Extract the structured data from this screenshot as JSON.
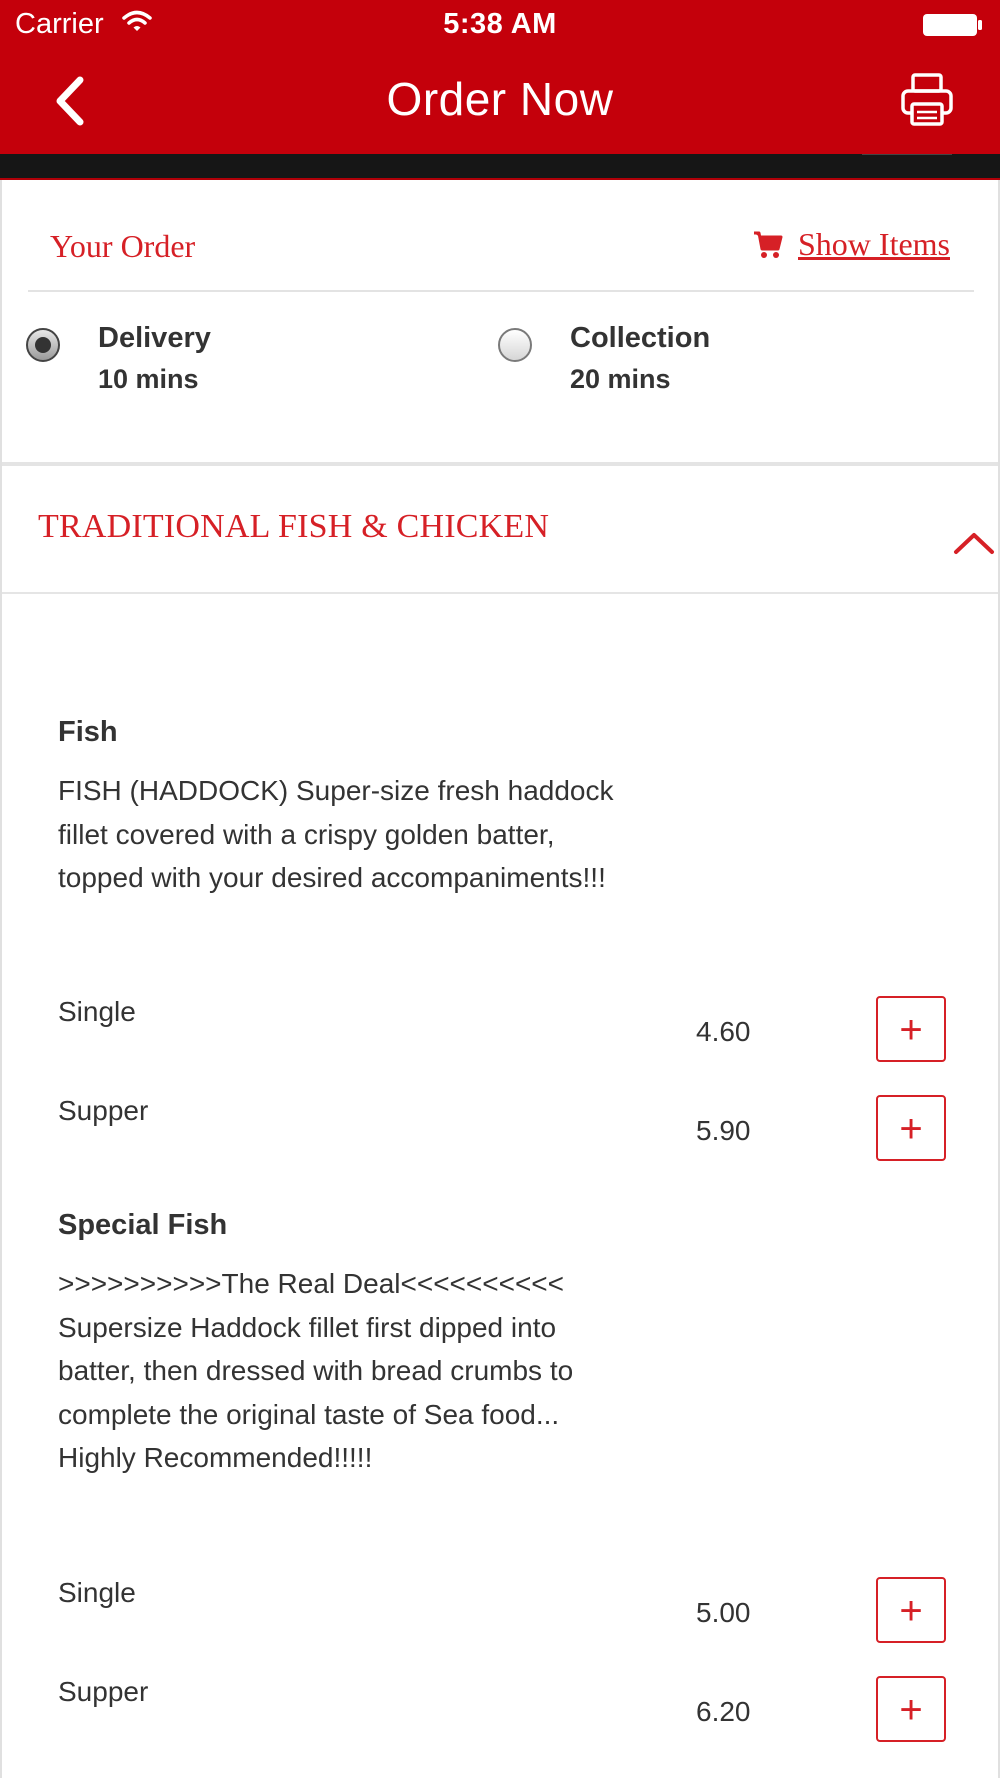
{
  "status_bar": {
    "carrier": "Carrier",
    "time": "5:38 AM"
  },
  "nav": {
    "title": "Order Now",
    "back_icon": "chevron-left-icon",
    "print_icon": "printer-icon"
  },
  "colors": {
    "brand_red": "#c4000b",
    "accent_red": "#d62026"
  },
  "order": {
    "heading": "Your Order",
    "show_items_label": "Show Items",
    "cart_icon": "cart-icon",
    "options": [
      {
        "name": "Delivery",
        "eta": "10 mins",
        "selected": true
      },
      {
        "name": "Collection",
        "eta": "20 mins",
        "selected": false
      }
    ]
  },
  "category": {
    "title": "TRADITIONAL FISH & CHICKEN",
    "expanded": true
  },
  "items": [
    {
      "name": "Fish",
      "description": "FISH (HADDOCK) Super-size fresh haddock fillet covered with a crispy golden batter, topped with your desired accompaniments!!!",
      "variants": [
        {
          "name": "Single",
          "price": "4.60"
        },
        {
          "name": "Supper",
          "price": "5.90"
        }
      ]
    },
    {
      "name": "Special Fish",
      "description": ">>>>>>>>>>The Real Deal<<<<<<<<<< Supersize Haddock fillet first dipped into batter, then dressed with bread crumbs to complete the original taste of Sea food... Highly Recommended!!!!!",
      "variants": [
        {
          "name": "Single",
          "price": "5.00"
        },
        {
          "name": "Supper",
          "price": "6.20"
        }
      ]
    }
  ],
  "add_button_label": "+"
}
